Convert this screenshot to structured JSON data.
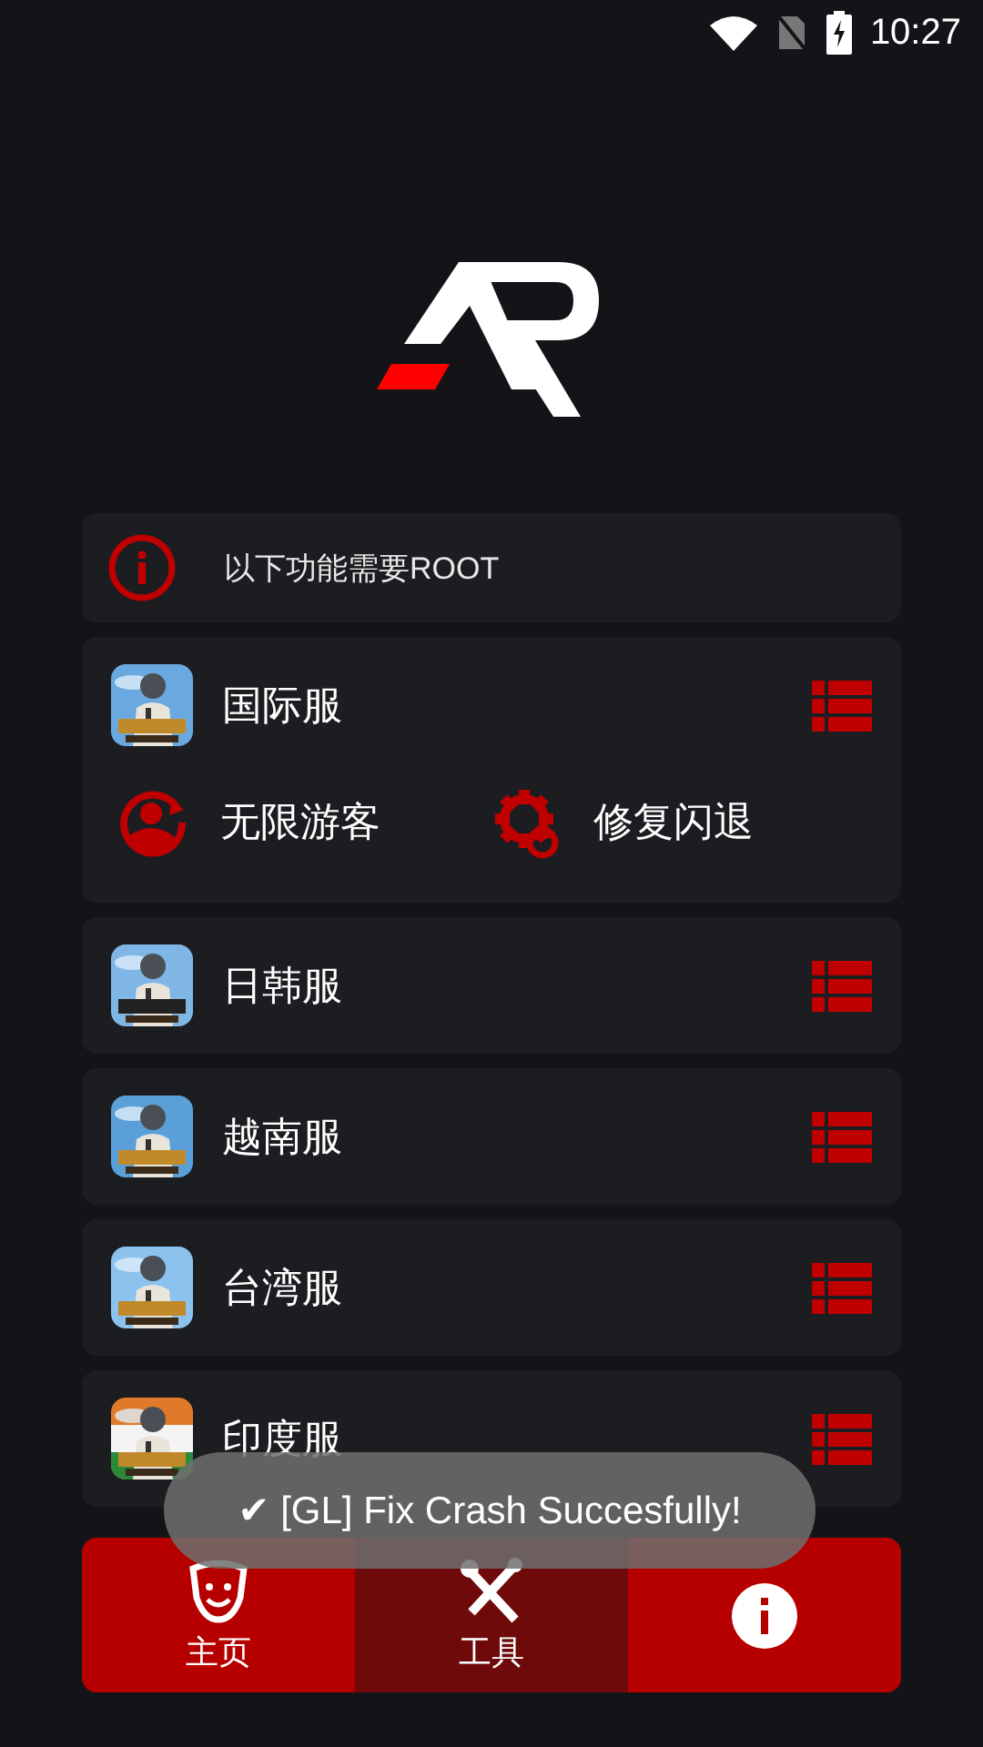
{
  "status_bar": {
    "time": "10:27"
  },
  "notice": {
    "text": "以下功能需要ROOT"
  },
  "servers": [
    {
      "name": "国际服",
      "expanded": true,
      "actions": [
        {
          "label": "无限游客",
          "kind": "guest"
        },
        {
          "label": "修复闪退",
          "kind": "repair"
        }
      ]
    },
    {
      "name": "日韩服",
      "expanded": false
    },
    {
      "name": "越南服",
      "expanded": false
    },
    {
      "name": "台湾服",
      "expanded": false
    },
    {
      "name": "印度服",
      "expanded": false
    }
  ],
  "nav": [
    {
      "label": "主页",
      "kind": "home",
      "selected": false
    },
    {
      "label": "工具",
      "kind": "tools",
      "selected": true
    },
    {
      "kind": "info",
      "selected": false
    }
  ],
  "toast": {
    "text": "✔ [GL] Fix Crash Succesfully!"
  }
}
